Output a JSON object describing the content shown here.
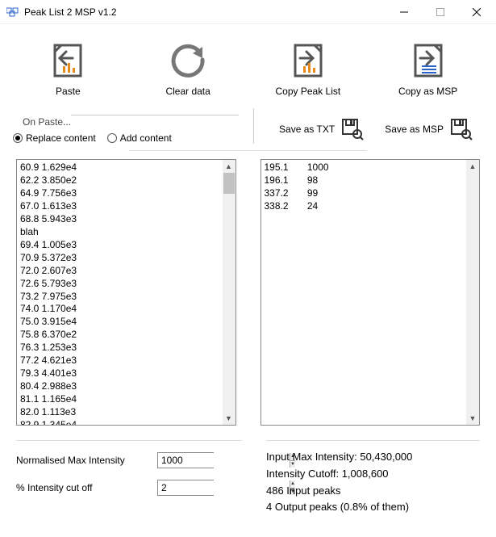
{
  "window": {
    "title": "Peak List 2 MSP v1.2"
  },
  "toolbar": {
    "paste": "Paste",
    "clear": "Clear data",
    "copy_peak": "Copy Peak List",
    "copy_msp": "Copy as MSP"
  },
  "on_paste": {
    "group_label": "On Paste...",
    "replace": "Replace content",
    "add": "Add content",
    "selected": "replace"
  },
  "save": {
    "txt": "Save as TXT",
    "msp": "Save as MSP"
  },
  "input_text": "60.9\t1.629e4\n62.2\t3.850e2\n64.9\t7.756e3\n67.0\t1.613e3\n68.8\t5.943e3\nblah\n69.4\t1.005e3\n70.9\t5.372e3\n72.0\t2.607e3\n72.6\t5.793e3\n73.2\t7.975e3\n74.0\t1.170e4\n75.0\t3.915e4\n75.8\t6.370e2\n76.3\t1.253e3\n77.2\t4.621e3\n79.3\t4.401e3\n80.4\t2.988e3\n81.1\t1.165e4\n82.0\t1.113e3\n82.9\t1.345e4",
  "output_text": "195.1\t1000\n196.1\t98\n337.2\t99\n338.2\t24",
  "controls": {
    "norm_max_label": "Normalised Max Intensity",
    "norm_max_value": "1000",
    "cutoff_label": "% Intensity cut off",
    "cutoff_value": "2"
  },
  "stats": {
    "max_intensity": "Input Max Intensity: 50,430,000",
    "cutoff": "Intensity Cutoff: 1,008,600",
    "input_peaks": "486 Input peaks",
    "output_peaks": "4 Output peaks  (0.8% of them)"
  }
}
